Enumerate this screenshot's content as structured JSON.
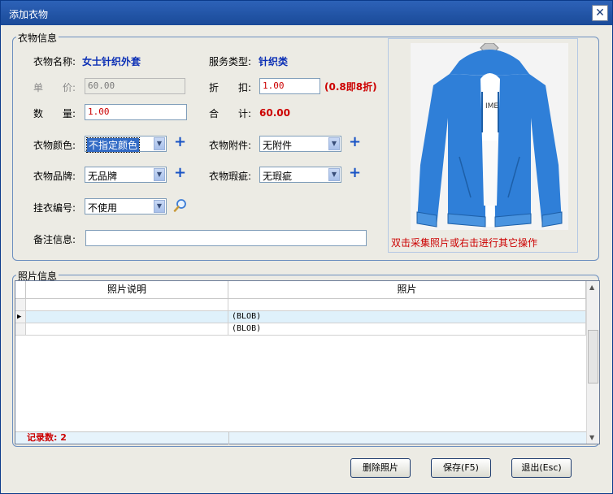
{
  "window": {
    "title": "添加衣物",
    "close_glyph": "✕"
  },
  "info_group": {
    "legend": "衣物信息",
    "name_label": "衣物名称:",
    "name_value": "女士针织外套",
    "service_label": "服务类型:",
    "service_value": "针织类",
    "price_label_a": "单",
    "price_label_b": "价:",
    "price_value": "60.00",
    "discount_label_a": "折",
    "discount_label_b": "扣:",
    "discount_value": "1.00",
    "discount_hint": "(0.8即8折)",
    "qty_label_a": "数",
    "qty_label_b": "量:",
    "qty_value": "1.00",
    "total_label_a": "合",
    "total_label_b": "计:",
    "total_value": "60.00",
    "color_label": "衣物颜色:",
    "color_value": "不指定颜色",
    "accessory_label": "衣物附件:",
    "accessory_value": "无附件",
    "brand_label": "衣物品牌:",
    "brand_value": "无品牌",
    "defect_label": "衣物瑕疵:",
    "defect_value": "无瑕疵",
    "hanger_label": "挂衣编号:",
    "hanger_value": "不使用",
    "remark_label": "备注信息:",
    "remark_value": "",
    "photo_hint": "双击采集照片或右击进行其它操作"
  },
  "photo_group": {
    "legend": "照片信息",
    "columns": [
      "照片说明",
      "照片"
    ],
    "rows": [
      {
        "desc": "",
        "photo": ""
      },
      {
        "desc": "",
        "photo": "(BLOB)"
      },
      {
        "desc": "",
        "photo": "(BLOB)"
      }
    ],
    "record_count": "记录数: 2"
  },
  "buttons": {
    "delete_photo": "删除照片",
    "save": "保存(F5)",
    "exit": "退出(Esc)"
  },
  "colors": {
    "accent_blue": "#0b2fb5",
    "alert_red": "#cc0000",
    "jacket_blue": "#2f7fd8"
  }
}
